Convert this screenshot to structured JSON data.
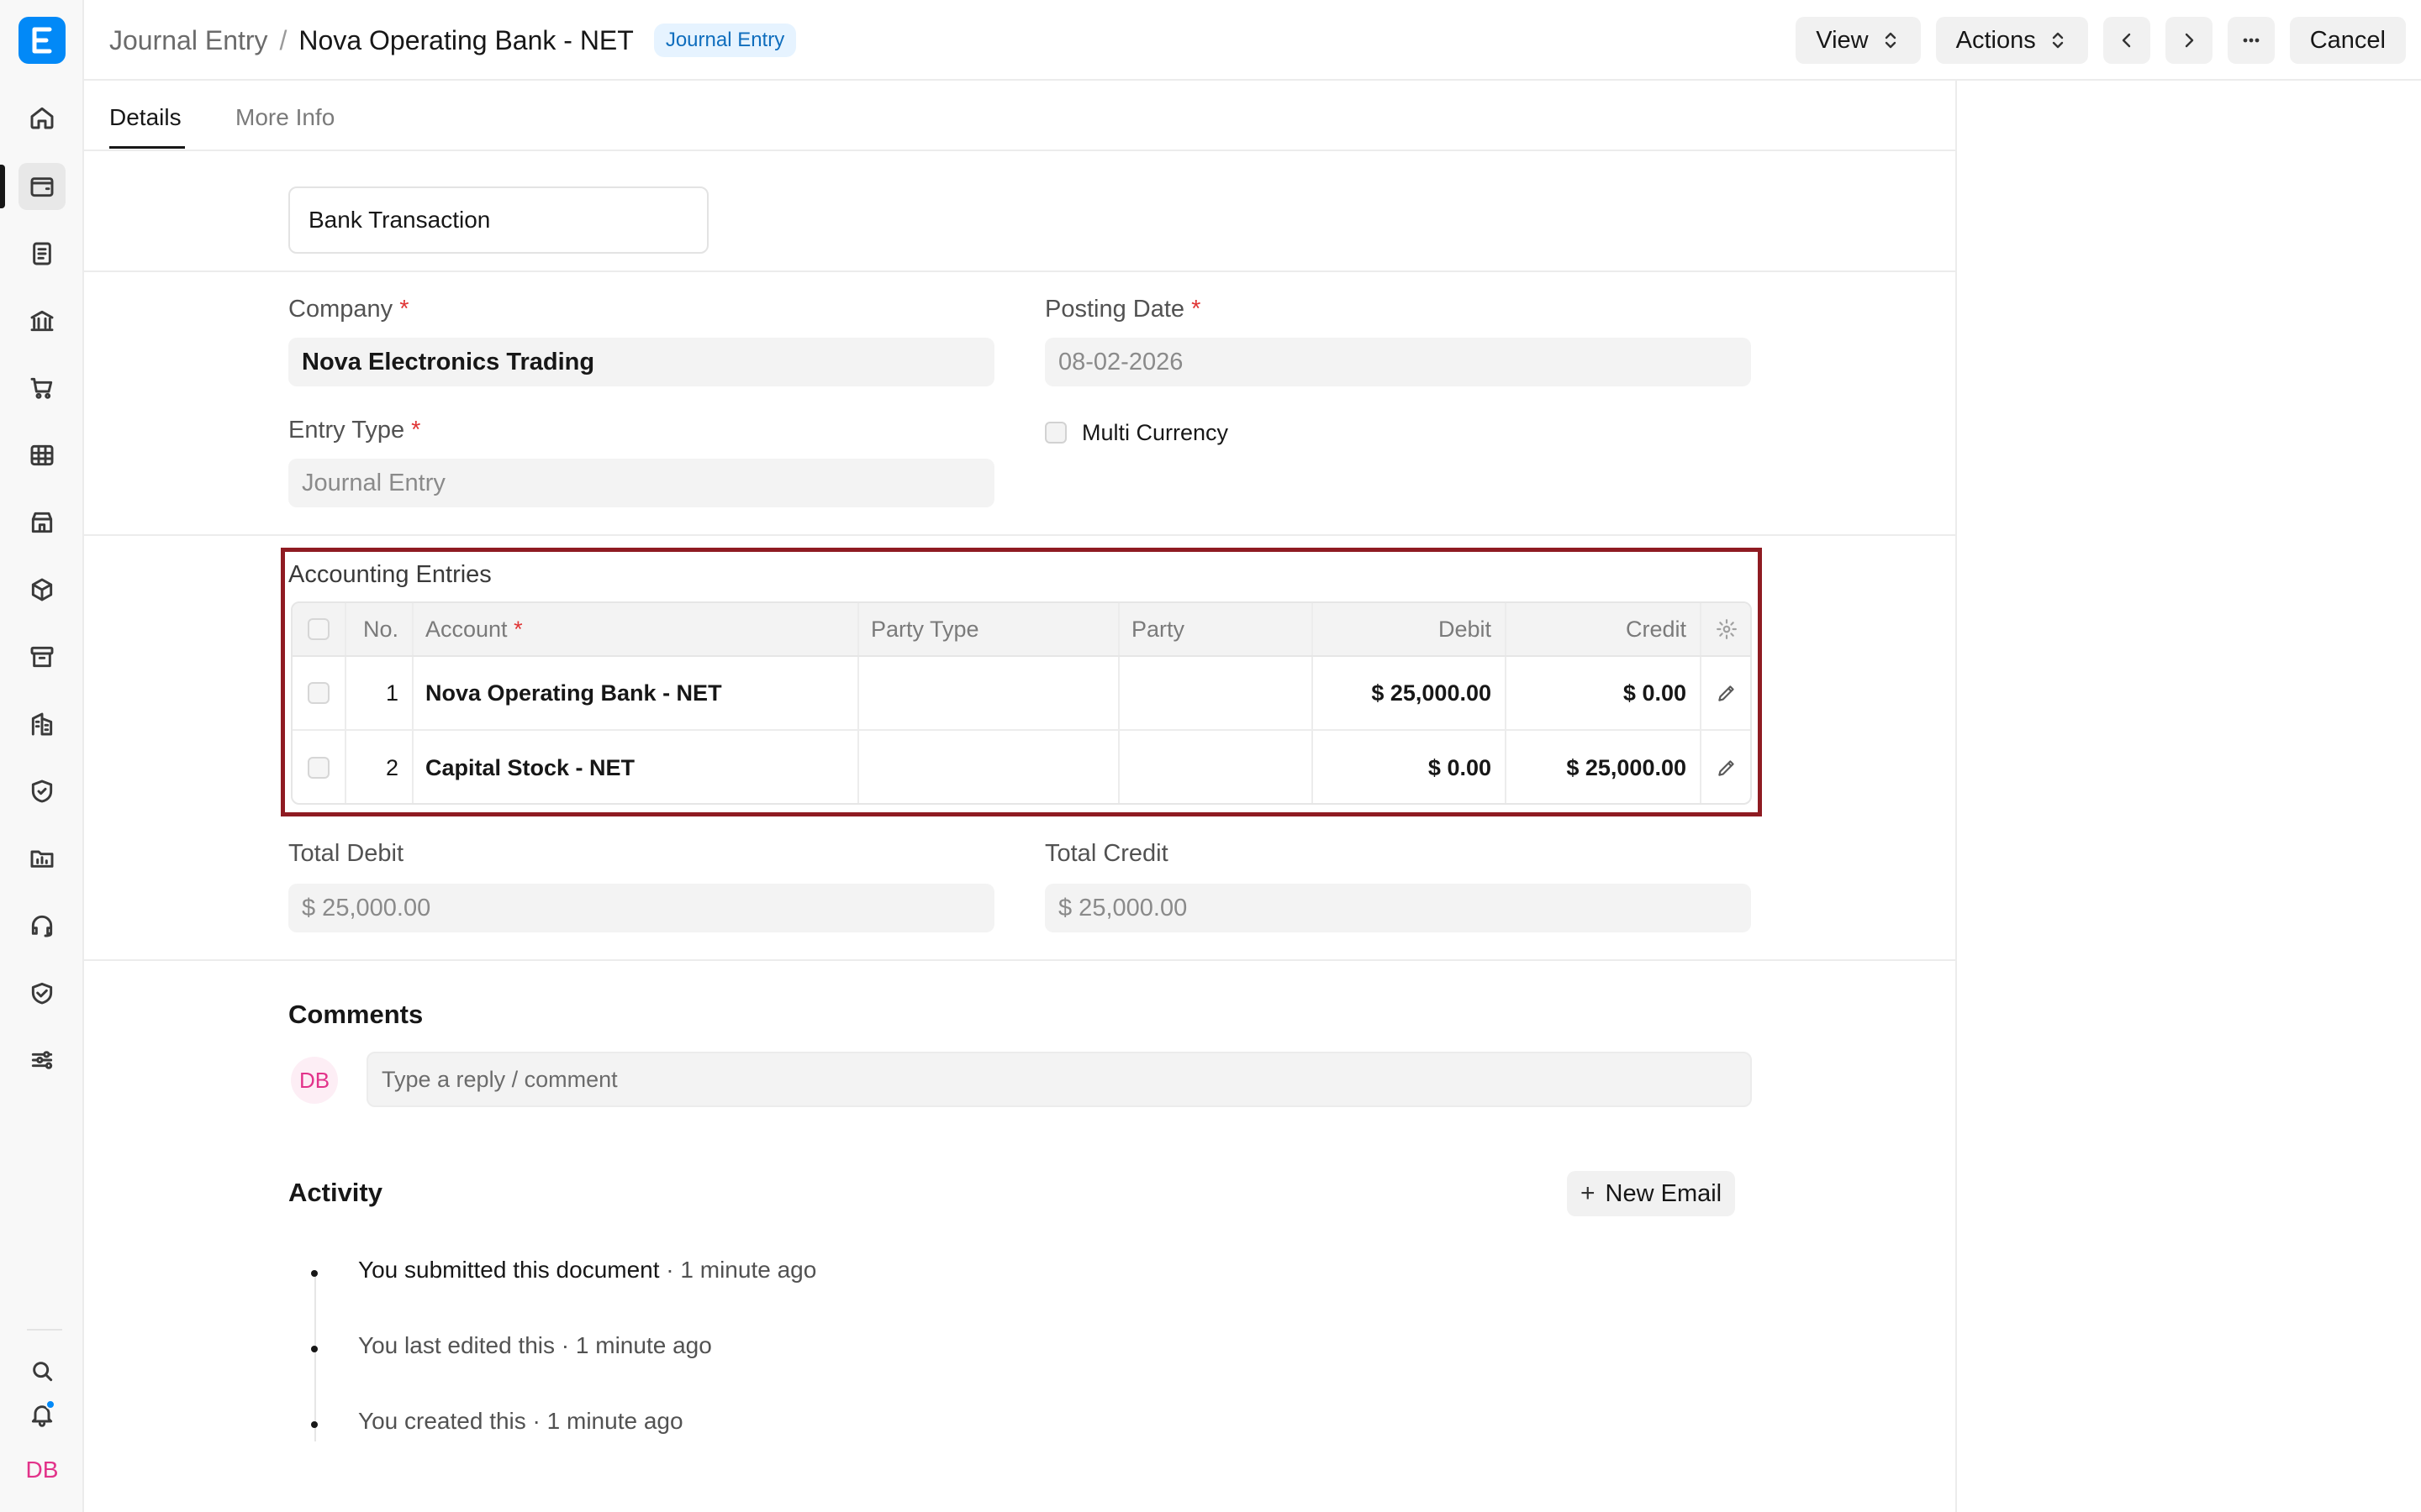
{
  "app": {
    "logo_letter": "E",
    "user_initials": "DB"
  },
  "sidebar": {
    "items": [
      {
        "icon": "home-icon"
      },
      {
        "icon": "wallet-icon",
        "active": true
      },
      {
        "icon": "file-text-icon"
      },
      {
        "icon": "bank-icon"
      },
      {
        "icon": "shopping-cart-icon"
      },
      {
        "icon": "table-icon"
      },
      {
        "icon": "store-icon"
      },
      {
        "icon": "package-icon"
      },
      {
        "icon": "archive-icon"
      },
      {
        "icon": "building-icon"
      },
      {
        "icon": "shield-icon"
      },
      {
        "icon": "folder-chart-icon"
      },
      {
        "icon": "headset-icon"
      },
      {
        "icon": "handshake-icon"
      },
      {
        "icon": "sliders-icon"
      }
    ],
    "bottom": [
      {
        "icon": "search-icon"
      },
      {
        "icon": "bell-icon"
      }
    ]
  },
  "header": {
    "breadcrumb_parent": "Journal Entry",
    "breadcrumb_separator": "/",
    "title": "Nova Operating Bank - NET",
    "status_badge": "Journal Entry",
    "view_label": "View",
    "actions_label": "Actions",
    "cancel_label": "Cancel"
  },
  "tabs": [
    {
      "label": "Details",
      "active": true
    },
    {
      "label": "More Info"
    }
  ],
  "form": {
    "series_value": "Bank Transaction",
    "company_label": "Company",
    "company_value": "Nova Electronics Trading",
    "posting_date_label": "Posting Date",
    "posting_date_value": "08-02-2026",
    "entry_type_label": "Entry Type",
    "entry_type_value": "Journal Entry",
    "multi_currency_label": "Multi Currency",
    "required_mark": "*"
  },
  "accounting": {
    "section_label": "Accounting Entries",
    "columns": {
      "no": "No.",
      "account": "Account",
      "party_type": "Party Type",
      "party": "Party",
      "debit": "Debit",
      "credit": "Credit"
    },
    "rows": [
      {
        "no": "1",
        "account": "Nova Operating Bank - NET",
        "party_type": "",
        "party": "",
        "debit": "$ 25,000.00",
        "credit": "$ 0.00"
      },
      {
        "no": "2",
        "account": "Capital Stock - NET",
        "party_type": "",
        "party": "",
        "debit": "$ 0.00",
        "credit": "$ 25,000.00"
      }
    ]
  },
  "totals": {
    "total_debit_label": "Total Debit",
    "total_debit_value": "$ 25,000.00",
    "total_credit_label": "Total Credit",
    "total_credit_value": "$ 25,000.00"
  },
  "comments": {
    "title": "Comments",
    "avatar": "DB",
    "placeholder": "Type a reply / comment"
  },
  "activity": {
    "title": "Activity",
    "new_email_label": "New Email",
    "items": [
      {
        "action": "You submitted this document",
        "time": " · 1 minute ago"
      },
      {
        "action": "You last edited this",
        "time": " · 1 minute ago"
      },
      {
        "action": "You created this",
        "time": " · 1 minute ago"
      }
    ]
  },
  "colors": {
    "accent": "#0289f7",
    "highlight_border": "#8f1b22",
    "required": "#e03636",
    "badge_text": "#0f6dbd",
    "avatar_text": "#e2338a"
  }
}
